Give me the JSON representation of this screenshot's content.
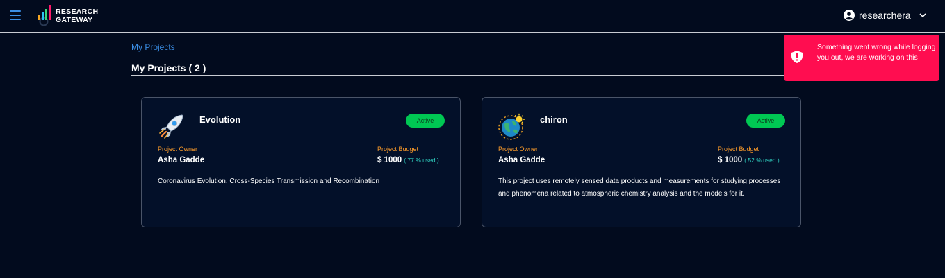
{
  "header": {
    "logo_line1": "RESEARCH",
    "logo_line2": "GATEWAY",
    "username": "researchera"
  },
  "toast": {
    "message": "Something went wrong while logging you out, we are working on this"
  },
  "breadcrumb": "My Projects",
  "page_title": "My Projects ( 2 )",
  "projects": [
    {
      "name": "Evolution",
      "status": "Active",
      "owner_label": "Project Owner",
      "owner": "Asha Gadde",
      "budget_label": "Project Budget",
      "budget": "$ 1000",
      "budget_used": "( 77 % used )",
      "description": "Coronavirus Evolution, Cross-Species Transmission and Recombination",
      "icon": "rocket-icon"
    },
    {
      "name": "chiron",
      "status": "Active",
      "owner_label": "Project Owner",
      "owner": "Asha Gadde",
      "budget_label": "Project Budget",
      "budget": "$ 1000",
      "budget_used": "( 52 % used )",
      "description": "This project uses remotely sensed data products and measurements for studying processes and phenomena related to atmospheric chemistry analysis and the models for it.",
      "icon": "globe-sun-icon"
    }
  ],
  "colors": {
    "background": "#020b1e",
    "accent_blue": "#3a8ee6",
    "toast": "#ff0d50",
    "status_active": "#00c853",
    "label_orange": "#ff9d2a",
    "used_teal": "#2fd0c0"
  }
}
